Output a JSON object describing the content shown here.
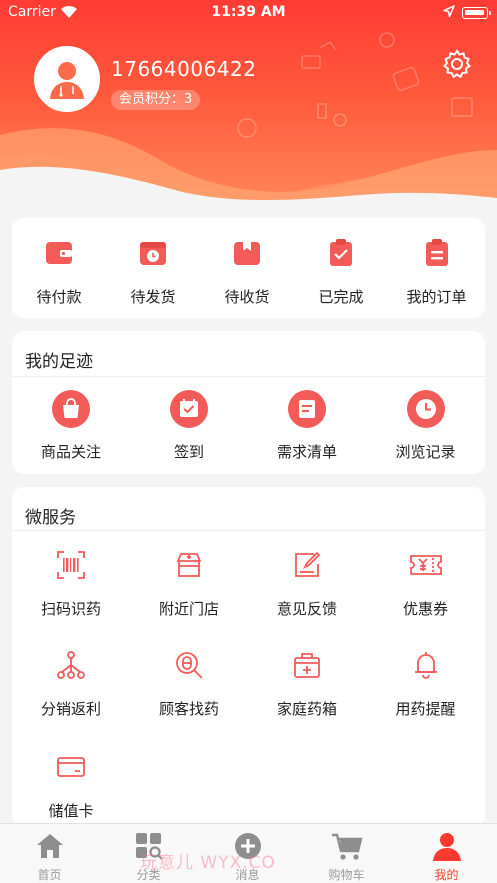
{
  "status_bar": {
    "carrier": "Carrier",
    "time": "11:39 AM"
  },
  "profile": {
    "phone": "17664006422",
    "points_label": "会员积分：3"
  },
  "orders": {
    "items": [
      {
        "label": "待付款",
        "icon": "wallet-icon"
      },
      {
        "label": "待发货",
        "icon": "box-clock-icon"
      },
      {
        "label": "待收货",
        "icon": "package-icon"
      },
      {
        "label": "已完成",
        "icon": "clipboard-check-icon"
      },
      {
        "label": "我的订单",
        "icon": "order-list-icon"
      }
    ]
  },
  "footprint": {
    "title": "我的足迹",
    "items": [
      {
        "label": "商品关注",
        "icon": "shopping-bag-icon"
      },
      {
        "label": "签到",
        "icon": "calendar-check-icon"
      },
      {
        "label": "需求清单",
        "icon": "list-icon"
      },
      {
        "label": "浏览记录",
        "icon": "clock-icon"
      }
    ]
  },
  "services": {
    "title": "微服务",
    "items": [
      {
        "label": "扫码识药",
        "icon": "barcode-scan-icon"
      },
      {
        "label": "附近门店",
        "icon": "store-icon"
      },
      {
        "label": "意见反馈",
        "icon": "feedback-edit-icon"
      },
      {
        "label": "优惠券",
        "icon": "coupon-icon"
      },
      {
        "label": "分销返利",
        "icon": "network-icon"
      },
      {
        "label": "顾客找药",
        "icon": "pill-search-icon"
      },
      {
        "label": "家庭药箱",
        "icon": "medicine-box-icon"
      },
      {
        "label": "用药提醒",
        "icon": "bell-icon"
      },
      {
        "label": "储值卡",
        "icon": "card-icon"
      }
    ]
  },
  "tabbar": {
    "tabs": [
      {
        "label": "首页",
        "icon": "home-icon"
      },
      {
        "label": "分类",
        "icon": "category-icon"
      },
      {
        "label": "消息",
        "icon": "message-plus-icon"
      },
      {
        "label": "购物车",
        "icon": "cart-icon"
      },
      {
        "label": "我的",
        "icon": "person-icon",
        "active": true
      }
    ]
  },
  "watermark": "玩意儿 WYX.CO",
  "colors": {
    "accent": "#ff3b30",
    "icon_red": "#f25b57"
  }
}
